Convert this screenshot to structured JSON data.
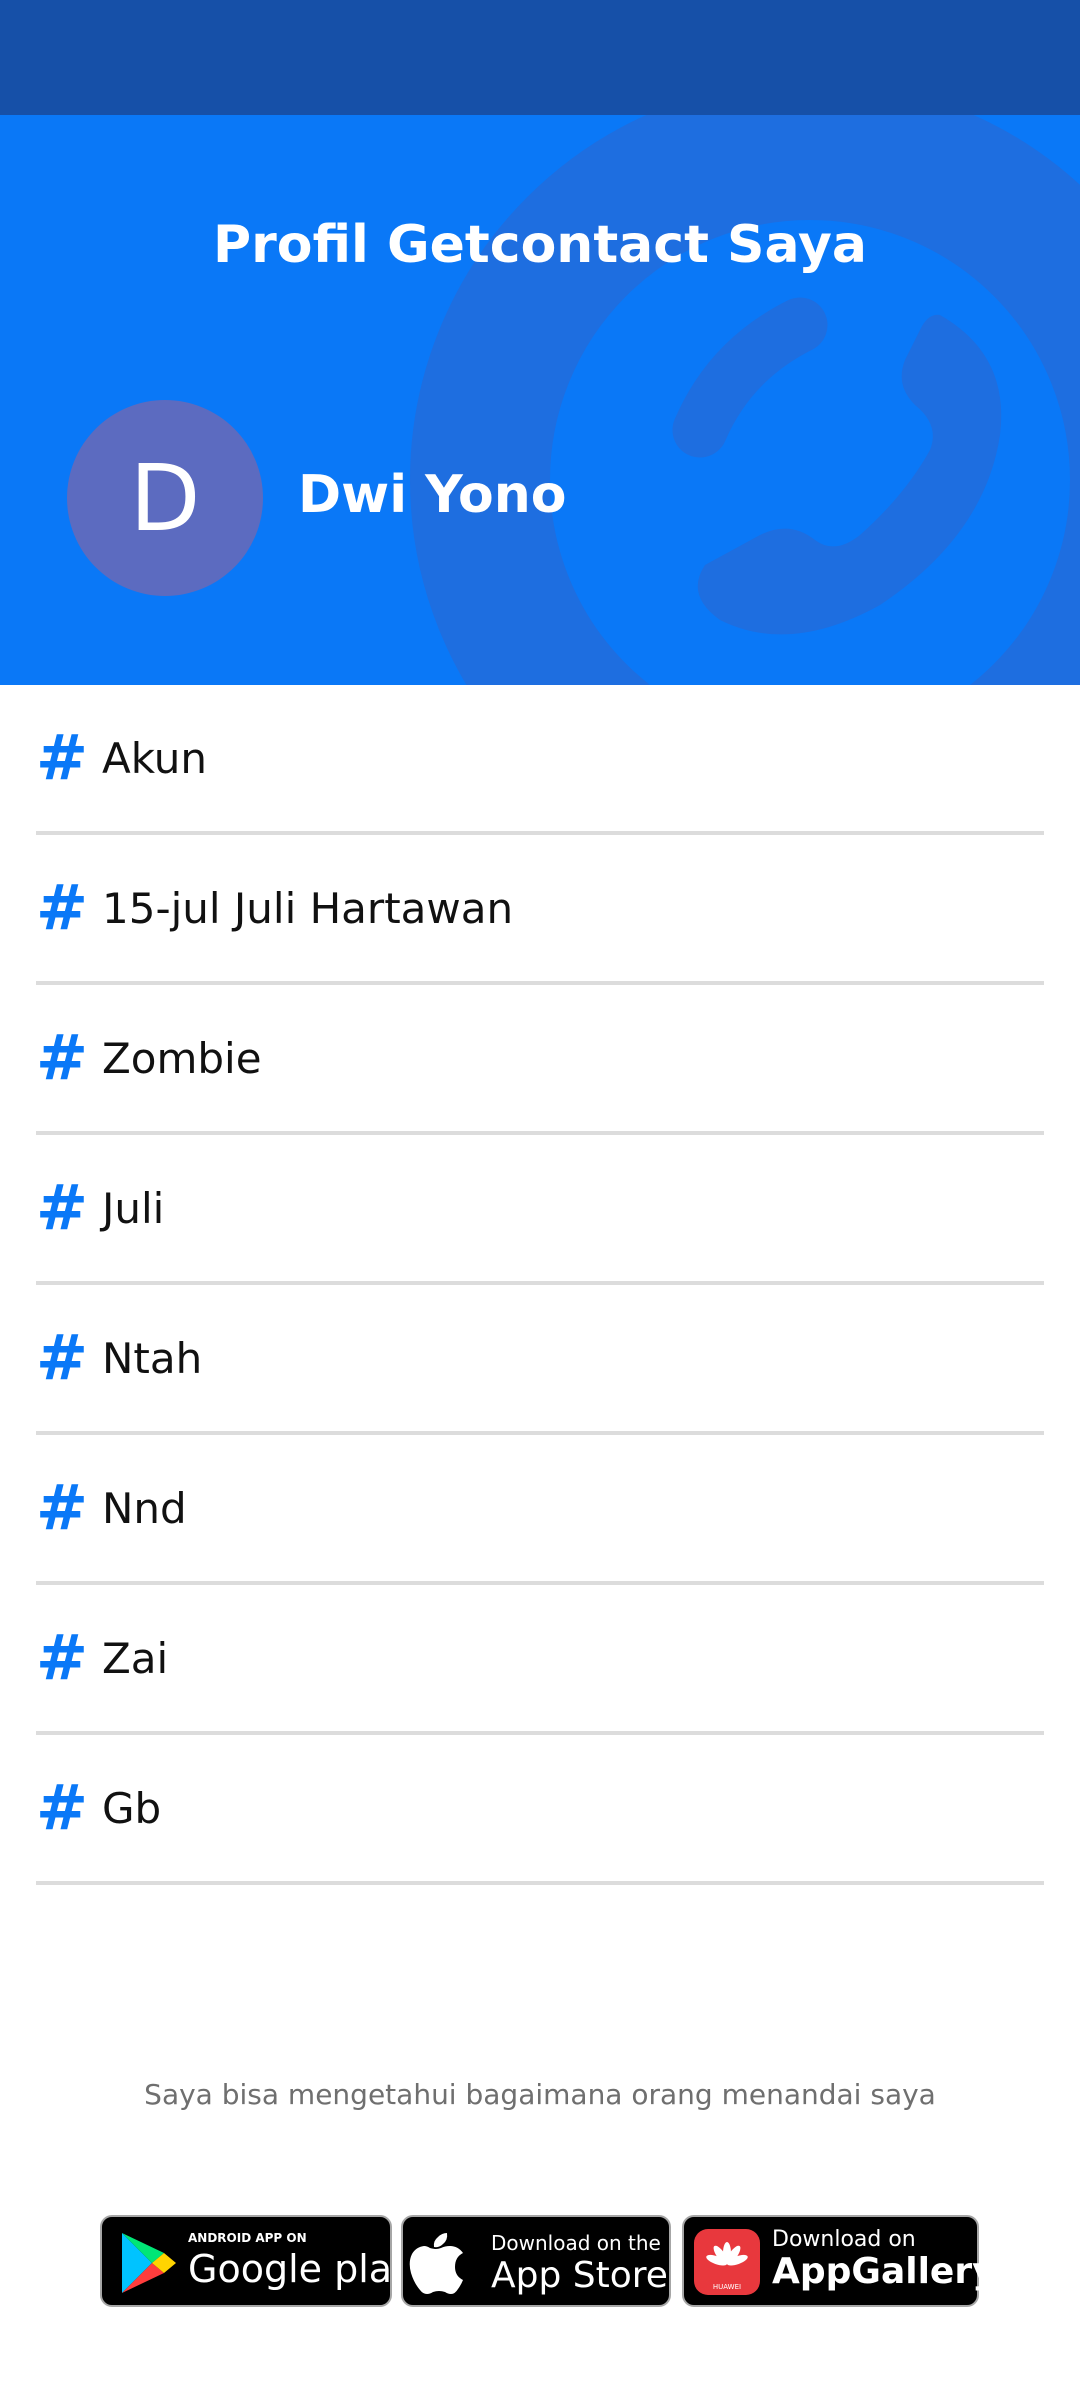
{
  "header": {
    "title": "Profil Getcontact Saya",
    "background_icon": "phone-icon"
  },
  "profile": {
    "initial": "D",
    "name": "Dwi Yono",
    "avatar_color": "#5c6bc0"
  },
  "tags": [
    {
      "icon": "#",
      "label": "Akun"
    },
    {
      "icon": "#",
      "label": "15-jul Juli Hartawan"
    },
    {
      "icon": "#",
      "label": "Zombie"
    },
    {
      "icon": "#",
      "label": "Juli"
    },
    {
      "icon": "#",
      "label": "Ntah"
    },
    {
      "icon": "#",
      "label": "Nnd"
    },
    {
      "icon": "#",
      "label": "Zai"
    },
    {
      "icon": "#",
      "label": "Gb"
    }
  ],
  "footer": {
    "text": "Saya bisa mengetahui bagaimana orang menandai saya"
  },
  "stores": {
    "google": {
      "small": "ANDROID APP ON",
      "big": "Google play",
      "icon": "google-play-icon"
    },
    "apple": {
      "small": "Download on the",
      "big": "App Store",
      "icon": "apple-icon"
    },
    "huawei": {
      "small": "Download on",
      "big": "AppGallery",
      "icon": "huawei-icon",
      "logo_text": "HUAWEI"
    }
  },
  "colors": {
    "status_bar": "#1650a8",
    "header_bg": "#0a78f7",
    "accent": "#0a78f7",
    "divider": "#dcdcdc"
  }
}
